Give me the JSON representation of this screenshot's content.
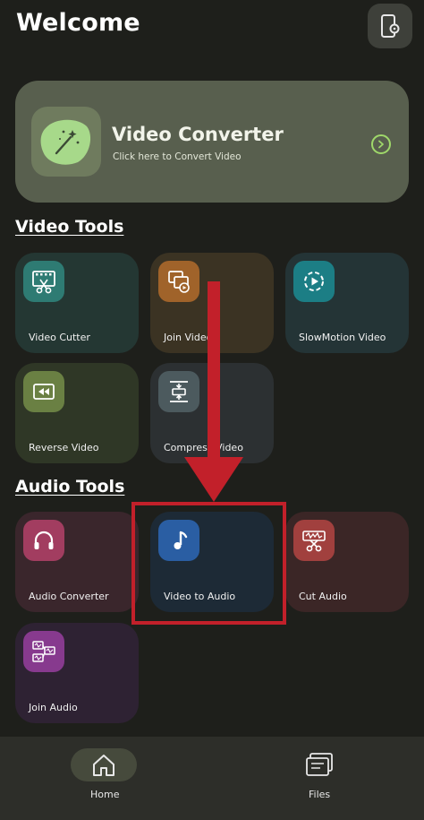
{
  "header": {
    "title": "Welcome",
    "settings_icon": "phone-settings-icon"
  },
  "banner": {
    "title": "Video Converter",
    "subtitle": "Click here to Convert Video",
    "icon": "magic-wand-icon",
    "action_icon": "chevron-right-circle-icon",
    "accent": "#9fd86a"
  },
  "sections": {
    "video_tools": "Video Tools",
    "audio_tools": "Audio Tools"
  },
  "video_tools": [
    {
      "label": "Video Cutter",
      "icon": "film-scissors-icon",
      "bg": "#243733",
      "icon_bg": "#2e7b73"
    },
    {
      "label": "Join Video",
      "icon": "join-video-icon",
      "bg": "#3b3323",
      "icon_bg": "#a0632a"
    },
    {
      "label": "SlowMotion Video",
      "icon": "slow-motion-icon",
      "bg": "#243436",
      "icon_bg": "#1c7e85"
    },
    {
      "label": "Reverse Video",
      "icon": "reverse-video-icon",
      "bg": "#2f3726",
      "icon_bg": "#6a8043"
    },
    {
      "label": "Compress Video",
      "icon": "compress-video-icon",
      "bg": "#2c3032",
      "icon_bg": "#4c5a5e"
    }
  ],
  "audio_tools": [
    {
      "label": "Audio Converter",
      "icon": "headphones-icon",
      "bg": "#3a262c",
      "icon_bg": "#a23d60"
    },
    {
      "label": "Video to Audio",
      "icon": "music-note-icon",
      "bg": "#1d2a36",
      "icon_bg": "#2a5ea3"
    },
    {
      "label": "Cut Audio",
      "icon": "audio-scissors-icon",
      "bg": "#3b2626",
      "icon_bg": "#a1403e"
    },
    {
      "label": "Join Audio",
      "icon": "join-audio-icon",
      "bg": "#2e2233",
      "icon_bg": "#873a8e"
    }
  ],
  "nav": {
    "home": "Home",
    "files": "Files"
  },
  "annotation": {
    "color": "#c2202a"
  }
}
